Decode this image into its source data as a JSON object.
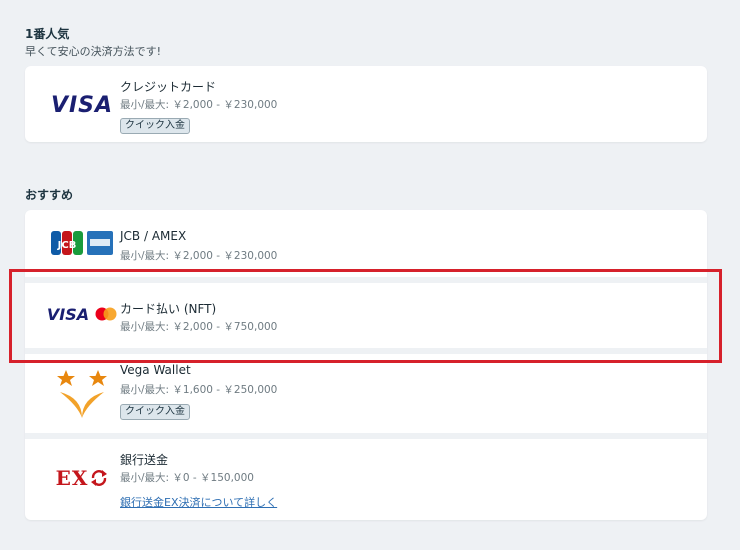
{
  "sections": {
    "popular": {
      "title": "1番人気",
      "subtitle": "早くて安心の決済方法です!"
    },
    "recommended": {
      "title": "おすすめ"
    }
  },
  "methods": [
    {
      "name": "クレジットカード",
      "range": "最小/最大: ￥2,000 - ￥230,000",
      "badge": "クイック入金",
      "logo_text": "VISA",
      "icon": "visa-logo"
    },
    {
      "name": "JCB / AMEX",
      "range": "最小/最大: ￥2,000 - ￥230,000",
      "logo_text": "JCB",
      "icon": "jcb-amex-logo"
    },
    {
      "name": "カード払い (NFT)",
      "range": "最小/最大: ￥2,000 - ￥750,000",
      "logo_text": "VISA",
      "icon": "visa-mastercard-logo",
      "highlighted": true
    },
    {
      "name": "Vega Wallet",
      "range": "最小/最大: ￥1,600 - ￥250,000",
      "badge": "クイック入金",
      "icon": "vega-wallet-logo"
    },
    {
      "name": "銀行送金",
      "range": "最小/最大: ￥0 - ￥150,000",
      "link": "銀行送金EX決済について詳しく",
      "logo_text": "EX",
      "icon": "bank-ex-logo"
    }
  ],
  "colors": {
    "background": "#eef1f4",
    "highlight": "#d6212b",
    "visa_blue": "#1a1f71",
    "link": "#2f6fb3"
  }
}
